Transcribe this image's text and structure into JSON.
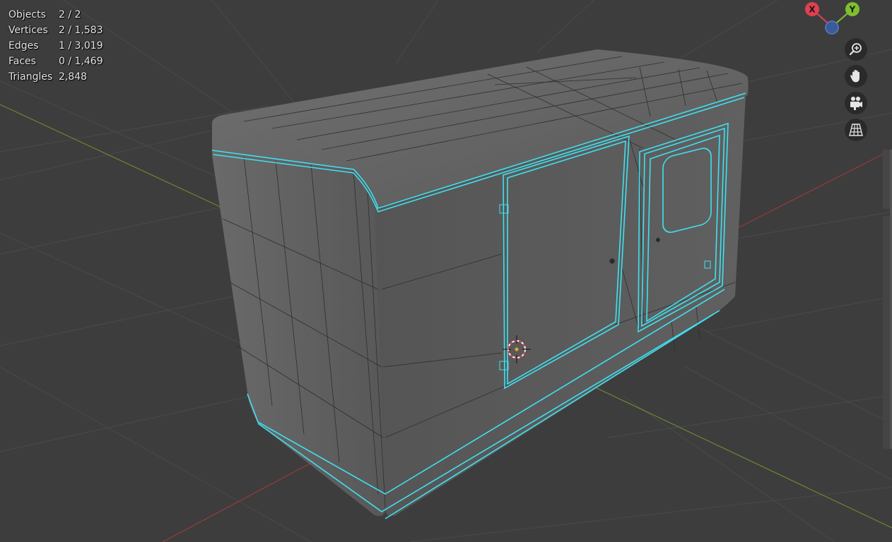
{
  "stats": [
    {
      "label": "Objects",
      "value": "2 / 2"
    },
    {
      "label": "Vertices",
      "value": "2 / 1,583"
    },
    {
      "label": "Edges",
      "value": "1 / 3,019"
    },
    {
      "label": "Faces",
      "value": "0 / 1,469"
    },
    {
      "label": "Triangles",
      "value": "2,848"
    }
  ],
  "gizmo": {
    "x_label": "X",
    "y_label": "Y",
    "x_color": "#e0404f",
    "y_color": "#7fbf2f",
    "z_color": "#3a5a9a"
  },
  "nav_tools": [
    {
      "name": "zoom-icon"
    },
    {
      "name": "hand-pan-icon"
    },
    {
      "name": "camera-icon"
    },
    {
      "name": "perspective-grid-icon"
    }
  ],
  "colors": {
    "background": "#3d3d3d",
    "selection": "#3fe0f0",
    "mesh": "#5e5e5e"
  }
}
